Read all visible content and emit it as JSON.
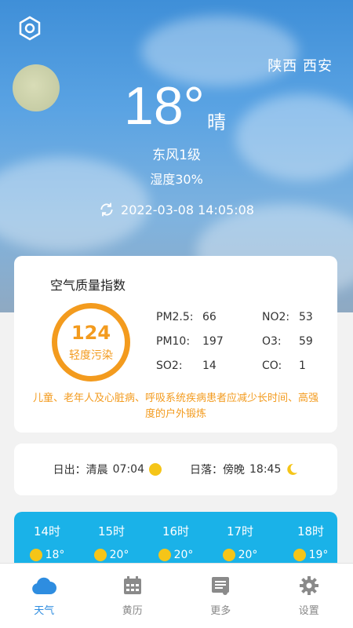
{
  "location": "陕西 西安",
  "weather": {
    "temperature": "18°",
    "condition": "晴",
    "wind": "东风1级",
    "humidity": "湿度30%",
    "updated": "2022-03-08 14:05:08"
  },
  "aqi": {
    "title": "空气质量指数",
    "value": "124",
    "level": "轻度污染",
    "pollutants": [
      {
        "label": "PM2.5:",
        "value": "66"
      },
      {
        "label": "NO2:",
        "value": "53"
      },
      {
        "label": "PM10:",
        "value": "197"
      },
      {
        "label": "O3:",
        "value": "59"
      },
      {
        "label": "SO2:",
        "value": "14"
      },
      {
        "label": "CO:",
        "value": "1"
      }
    ],
    "advice": "儿童、老年人及心脏病、呼吸系统疾病患者应减少长时间、高强度的户外锻炼",
    "accent_color": "#f39b1e"
  },
  "sun": {
    "sunrise_label": "日出：清晨",
    "sunrise_time": "07:04",
    "sunset_label": "日落：傍晚",
    "sunset_time": "18:45"
  },
  "hourly": [
    {
      "hour": "14时",
      "temp": "18°",
      "icon": "sun-icon"
    },
    {
      "hour": "15时",
      "temp": "20°",
      "icon": "sun-icon"
    },
    {
      "hour": "16时",
      "temp": "20°",
      "icon": "sun-icon"
    },
    {
      "hour": "17时",
      "temp": "20°",
      "icon": "sun-icon"
    },
    {
      "hour": "18时",
      "temp": "19°",
      "icon": "sun-icon"
    }
  ],
  "tabs": [
    {
      "label": "天气",
      "icon": "cloud-icon",
      "active": true
    },
    {
      "label": "黄历",
      "icon": "calendar-icon",
      "active": false
    },
    {
      "label": "更多",
      "icon": "list-icon",
      "active": false
    },
    {
      "label": "设置",
      "icon": "gear-icon",
      "active": false
    }
  ],
  "colors": {
    "active_tab": "#2e8de0",
    "hourly_bg": "#1ab2e8"
  }
}
